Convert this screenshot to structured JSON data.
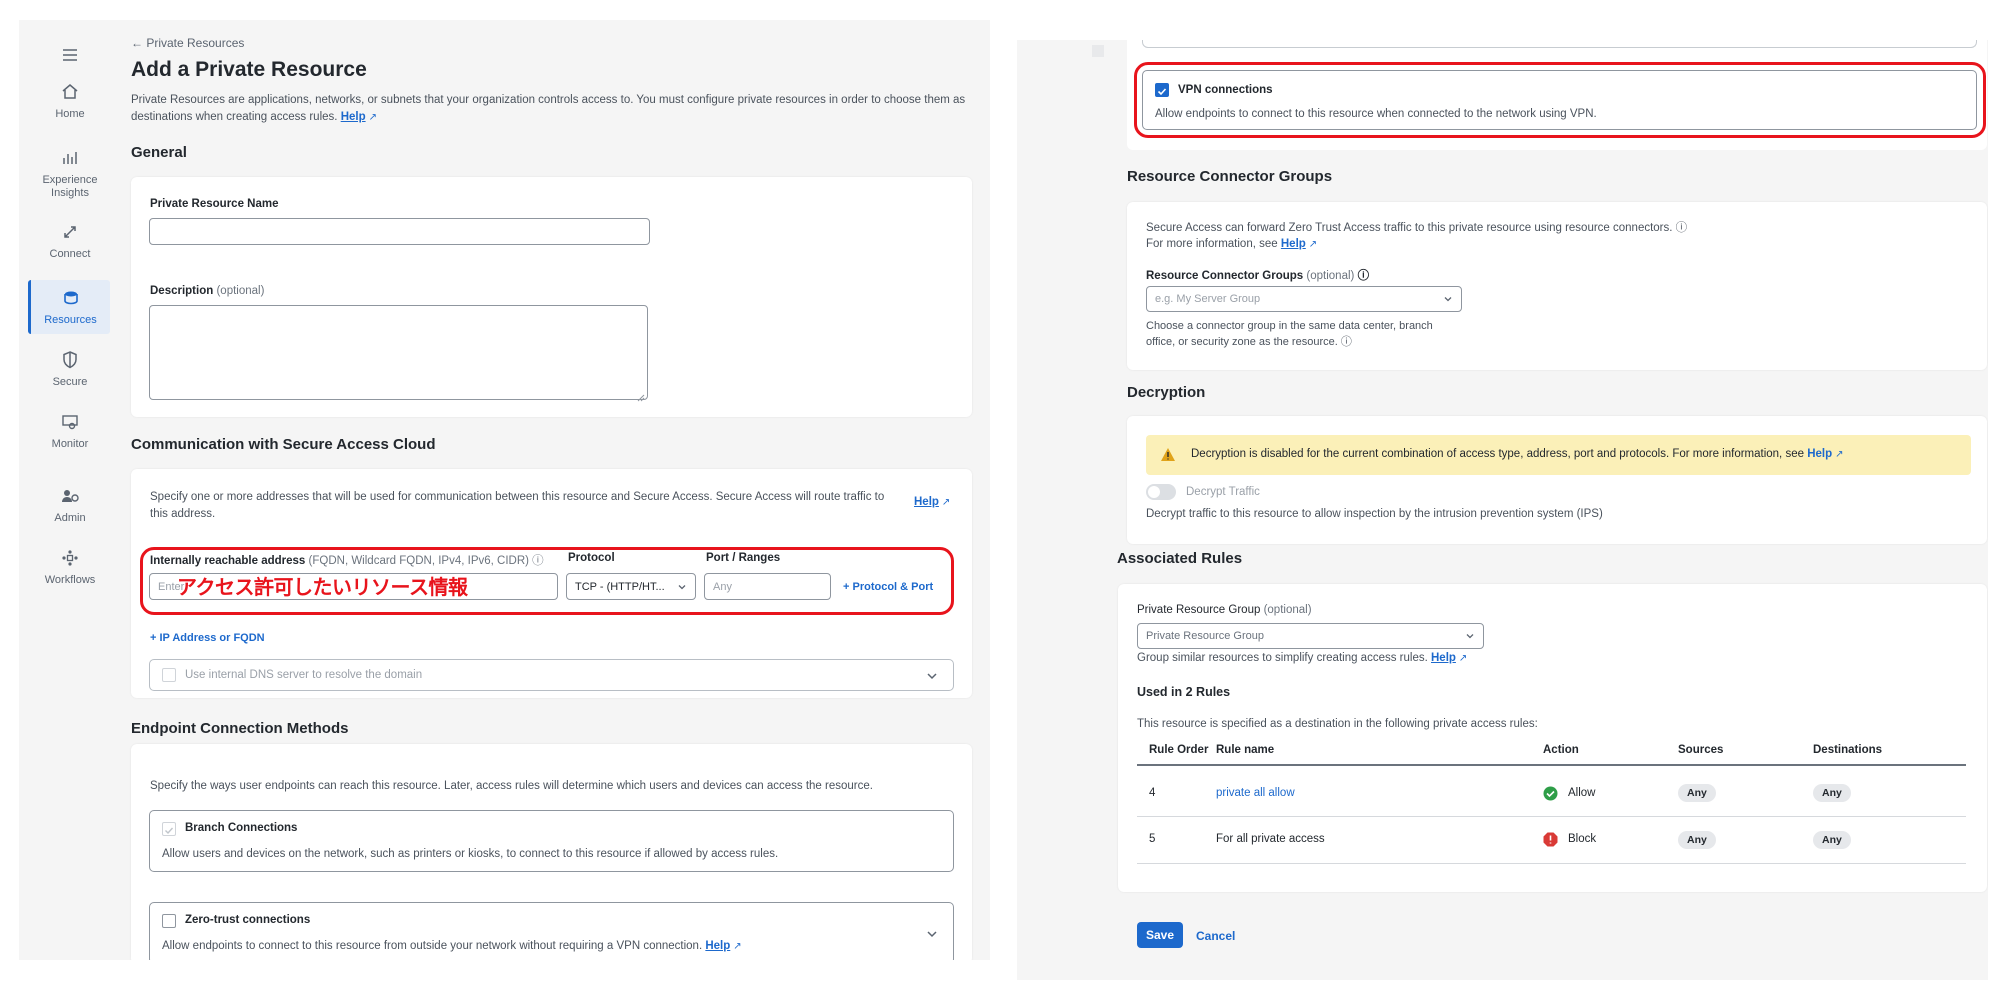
{
  "sidebar": {
    "items": [
      {
        "label": "Home",
        "icon": "home-icon"
      },
      {
        "label": "Experience Insights",
        "icon": "insights-icon"
      },
      {
        "label": "Connect",
        "icon": "connect-icon"
      },
      {
        "label": "Resources",
        "icon": "resources-icon",
        "active": true
      },
      {
        "label": "Secure",
        "icon": "shield-icon"
      },
      {
        "label": "Monitor",
        "icon": "monitor-icon"
      },
      {
        "label": "Admin",
        "icon": "admin-icon"
      },
      {
        "label": "Workflows",
        "icon": "workflows-icon"
      }
    ]
  },
  "header": {
    "back_link": "← Private Resources",
    "title": "Add a Private Resource",
    "description": "Private Resources are applications, networks, or subnets that your organization controls access to. You must configure private resources in order to choose them as destinations when creating access rules.",
    "help": "Help"
  },
  "general": {
    "heading": "General",
    "name_label": "Private Resource Name",
    "description_label": "Description",
    "optional": "(optional)"
  },
  "communication": {
    "heading": "Communication with Secure Access Cloud",
    "text": "Specify one or more addresses that will be used for communication between this resource and Secure Access. Secure Access will route traffic to this address.",
    "help": "Help",
    "address_label": "Internally reachable address",
    "address_hint": "(FQDN, Wildcard FQDN, IPv4, IPv6, CIDR)",
    "address_placeholder": "Enter",
    "protocol_label": "Protocol",
    "protocol_value": "TCP - (HTTP/HT...",
    "port_label": "Port / Ranges",
    "port_placeholder": "Any",
    "add_protocol_port": "+ Protocol & Port",
    "add_ip": "+ IP Address or FQDN",
    "dns_label": "Use internal DNS server to resolve the domain",
    "annotation": "アクセス許可したいリソース情報"
  },
  "endpoint": {
    "heading": "Endpoint Connection Methods",
    "text": "Specify the ways user endpoints can reach this resource. Later, access rules will determine which users and devices can access the resource.",
    "branch_title": "Branch Connections",
    "branch_desc": "Allow users and devices on the network, such as printers or kiosks, to connect to this resource if allowed by access rules.",
    "zt_title": "Zero-trust connections",
    "zt_desc": "Allow endpoints to connect to this resource from outside your network without requiring a VPN connection.",
    "help": "Help"
  },
  "vpn": {
    "title": "VPN connections",
    "desc": "Allow endpoints to connect to this resource when connected to the network using VPN."
  },
  "connector_groups": {
    "heading": "Resource Connector Groups",
    "line1": "Secure Access can forward Zero Trust Access traffic to this private resource using resource connectors.",
    "line2": "For more information, see",
    "help": "Help",
    "label": "Resource Connector Groups",
    "optional": "(optional)",
    "placeholder": "e.g. My Server Group",
    "hint1": "Choose a connector group in the same data center, branch",
    "hint2": "office, or security zone as the resource."
  },
  "decryption": {
    "heading": "Decryption",
    "warning": "Decryption is disabled for the current combination of access type, address, port and protocols. For more information, see",
    "help": "Help",
    "toggle_label": "Decrypt Traffic",
    "desc": "Decrypt traffic to this resource to allow inspection by the intrusion prevention system (IPS)"
  },
  "associated_rules": {
    "heading": "Associated Rules",
    "group_label": "Private Resource Group",
    "optional": "(optional)",
    "group_placeholder": "Private Resource Group",
    "group_hint": "Group similar resources to simplify creating access rules.",
    "help": "Help",
    "used_title": "Used in 2 Rules",
    "used_desc": "This resource is specified as a destination in the following private access rules:",
    "columns": [
      "Rule Order",
      "Rule name",
      "Action",
      "Sources",
      "Destinations"
    ],
    "rows": [
      {
        "order": "4",
        "name": "private all allow",
        "action": "Allow",
        "sources": "Any",
        "destinations": "Any"
      },
      {
        "order": "5",
        "name": "For all private access",
        "action": "Block",
        "sources": "Any",
        "destinations": "Any"
      }
    ]
  },
  "footer": {
    "save": "Save",
    "cancel": "Cancel"
  },
  "colors": {
    "accent": "#1d69cc",
    "highlight": "#e8141c",
    "allow": "#2e9e48",
    "block": "#d93a36",
    "warning_bg": "#fbf0b8"
  }
}
